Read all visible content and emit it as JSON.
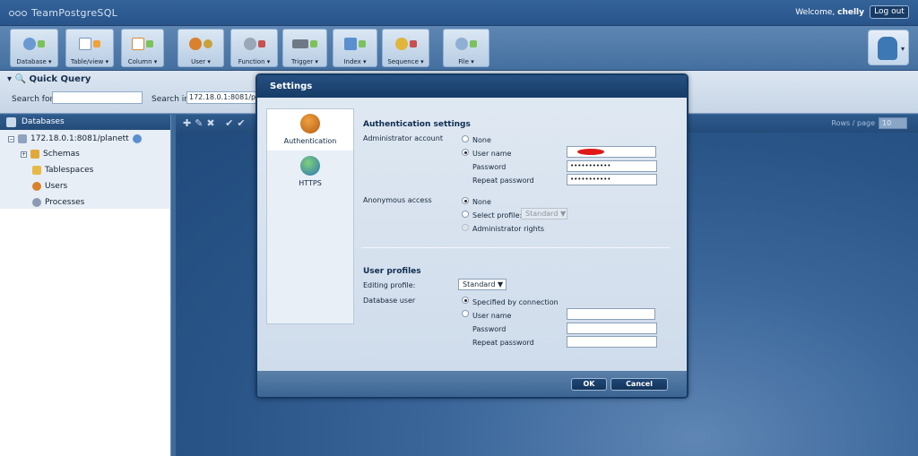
{
  "app": {
    "logo": "TeamPostgreSQL"
  },
  "header": {
    "welcome": "Welcome,",
    "username": "chelly",
    "logout_label": "Log out"
  },
  "toolbar": {
    "buttons": [
      {
        "label": "Database",
        "icon": "database-add-icon"
      },
      {
        "label": "Table/view",
        "icon": "table-add-icon"
      },
      {
        "label": "Column",
        "icon": "column-add-icon"
      },
      {
        "label": "User",
        "icon": "user-add-icon"
      },
      {
        "label": "Function",
        "icon": "function-gears-icon"
      },
      {
        "label": "Trigger",
        "icon": "trigger-icon"
      },
      {
        "label": "Index",
        "icon": "index-icon"
      },
      {
        "label": "Sequence",
        "icon": "sequence-icon"
      },
      {
        "label": "File",
        "icon": "file-icon"
      }
    ]
  },
  "quick_query": {
    "title": "Quick Query",
    "search_for_label": "Search for",
    "search_for_value": "",
    "search_in_label": "Search in",
    "search_in_value": "172.18.0.1:8081/planett"
  },
  "databases_panel": {
    "title": "Databases",
    "tree": [
      {
        "label": "172.18.0.1:8081/planett",
        "icon": "database-server-icon"
      },
      {
        "label": "Schemas",
        "icon": "schemas-icon"
      },
      {
        "label": "Tablespaces",
        "icon": "tablespaces-icon"
      },
      {
        "label": "Users",
        "icon": "users-icon"
      },
      {
        "label": "Processes",
        "icon": "processes-icon"
      }
    ]
  },
  "right_panel": {
    "rows_label": "Rows / page",
    "rows_value": "10"
  },
  "dialog": {
    "title": "Settings",
    "nav": [
      {
        "label": "Authentication",
        "icon": "user-lock-icon",
        "active": true
      },
      {
        "label": "HTTPS",
        "icon": "globe-lock-icon",
        "active": false
      }
    ],
    "auth": {
      "title": "Authentication settings",
      "admin_account_label": "Administrator account",
      "opt_none": "None",
      "opt_user_name": "User name",
      "username_value": "",
      "password_label": "Password",
      "password_value": "•••••••••••",
      "repeat_password_label": "Repeat password",
      "repeat_password_value": "•••••••••••",
      "anonymous_label": "Anonymous access",
      "anon_none": "None",
      "anon_select_profile": "Select profile:",
      "anon_profile_value": "Standard",
      "anon_admin_rights": "Administrator rights"
    },
    "profiles": {
      "title": "User profiles",
      "editing_profile_label": "Editing profile:",
      "editing_profile_value": "Standard",
      "database_user_label": "Database user",
      "opt_specified": "Specified by connection",
      "opt_user_name": "User name",
      "password_label": "Password",
      "repeat_password_label": "Repeat password"
    },
    "ok_label": "OK",
    "cancel_label": "Cancel"
  }
}
